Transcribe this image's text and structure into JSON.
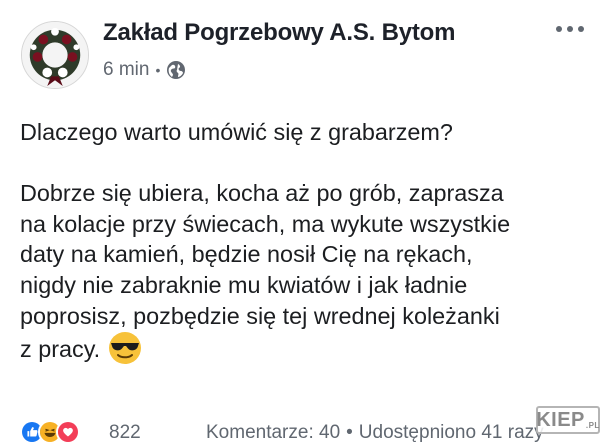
{
  "post": {
    "page_name": "Zakład Pogrzebowy A.S. Bytom",
    "time": "6 min",
    "separator": "•",
    "privacy_icon": "globe-icon",
    "more_icon": "more-options-icon",
    "question": "Dlaczego warto umówić się z grabarzem?",
    "lines": [
      "Dobrze się ubiera, kocha aż po grób, zaprasza",
      "na kolacje przy świecach, ma wykute wszystkie",
      "daty na kamień, będzie nosił Cię na rękach,",
      "nigdy nie zabraknie mu kwiatów i jak ładnie",
      "poprosisz, pozbędzie się tej wrednej koleżanki",
      "z pracy."
    ],
    "emoji": "smiling-face-with-sunglasses"
  },
  "footer": {
    "reactions": [
      "like-icon",
      "haha-icon",
      "love-icon"
    ],
    "reaction_count": "822",
    "comments": "Komentarze: 40",
    "dot": "•",
    "shares": "Udostępniono 41 razy"
  },
  "watermark": {
    "text": "KIEP",
    "suffix": ".PL"
  },
  "colors": {
    "like": "#1877f2",
    "haha": "#f7b125",
    "love": "#f33e58",
    "meta_text": "#616770"
  }
}
